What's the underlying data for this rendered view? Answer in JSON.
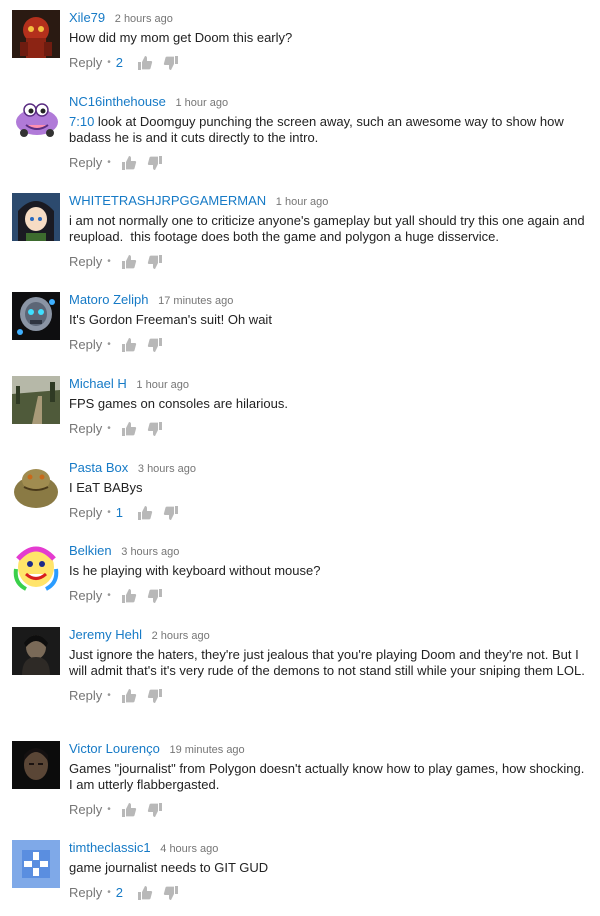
{
  "comments": [
    {
      "author": "Xile79",
      "time": "2 hours ago",
      "text": "How did my mom get Doom this early?",
      "likes": "2",
      "avatar": "red-robot-avatar"
    },
    {
      "author": "NC16inthehouse",
      "time": "1 hour ago",
      "timestamp_link": "7:10",
      "text": " look at Doomguy punching the screen away, such an awesome way to show how badass he is and it cuts directly to the intro.",
      "likes": "",
      "avatar": "purple-car-avatar"
    },
    {
      "author": "WHITETRASHJRPGGAMERMAN",
      "time": "1 hour ago",
      "text": "i am not normally one to criticize anyone's gameplay but yall should try this one again and reupload.  this footage does both the game and polygon a huge disservice.",
      "likes": "",
      "avatar": "anime-girl-avatar"
    },
    {
      "author": "Matoro Zeliph",
      "time": "17 minutes ago",
      "text": "It's Gordon Freeman's suit! Oh wait",
      "likes": "",
      "avatar": "robot-mask-avatar"
    },
    {
      "author": "Michael H",
      "time": "1 hour ago",
      "text": "FPS games on consoles are hilarious.",
      "likes": "",
      "avatar": "landscape-avatar"
    },
    {
      "author": "Pasta Box",
      "time": "3 hours ago",
      "text": "I EaT BABys",
      "likes": "1",
      "avatar": "jabba-avatar"
    },
    {
      "author": "Belkien",
      "time": "3 hours ago",
      "text": "Is he playing with keyboard without mouse?",
      "likes": "",
      "avatar": "rainbow-face-avatar"
    },
    {
      "author": "Jeremy Hehl",
      "time": "2 hours ago",
      "text": "Just ignore the haters, they're just jealous that you're playing Doom and they're not. But I will admit that's it's very rude of the demons to not stand still while your sniping them LOL.",
      "likes": "",
      "avatar": "dark-portrait-avatar"
    },
    {
      "author": "Victor Lourenço",
      "time": "19 minutes ago",
      "text": "Games \"journalist\" from Polygon doesn't actually know how to play games, how shocking. I am utterly flabbergasted.",
      "likes": "",
      "avatar": "face-portrait-avatar"
    },
    {
      "author": "timtheclassic1",
      "time": "4 hours ago",
      "text": "game journalist needs to GIT GUD",
      "likes": "2",
      "avatar": "default-blue-avatar"
    }
  ],
  "labels": {
    "reply": "Reply",
    "separator": "•"
  },
  "colors": {
    "author": "#167ac6",
    "meta": "#767676",
    "text": "#222222"
  }
}
